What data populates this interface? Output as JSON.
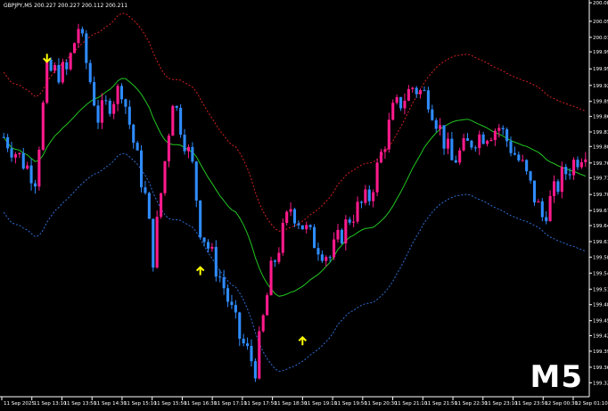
{
  "symbol_line": "GBPJPY,M5  200.227 200.227 200.112 200.211",
  "timeframe_badge": "M5",
  "colors": {
    "background": "#000000",
    "bull_candle": "#ff1a8c",
    "bear_candle": "#2f8cff",
    "middle_band": "#22c522",
    "upper_band": "#d42020",
    "lower_band": "#2f6fd6",
    "signal_arrow": "#ffff00",
    "axis_text": "#ffffff"
  },
  "chart_data": {
    "type": "candlestick",
    "symbol": "GBPJPY",
    "timeframe": "M5",
    "ylim": [
      199.31,
      200.09
    ],
    "y_ticks": [
      200.088,
      200.051,
      200.019,
      199.99,
      199.956,
      199.923,
      199.891,
      199.861,
      199.83,
      199.801,
      199.768,
      199.738,
      199.705,
      199.673,
      199.643,
      199.611,
      199.58,
      199.548,
      199.516,
      199.485,
      199.453,
      199.423,
      199.392,
      199.36,
      199.329
    ],
    "x_ticks": [
      "11 Sep 2025",
      "11 Sep 13:10",
      "11 Sep 13:50",
      "11 Sep 14:30",
      "11 Sep 15:10",
      "11 Sep 15:50",
      "11 Sep 16:30",
      "11 Sep 17:10",
      "11 Sep 17:50",
      "11 Sep 18:30",
      "11 Sep 19:10",
      "11 Sep 19:50",
      "11 Sep 20:30",
      "11 Sep 21:10",
      "11 Sep 21:50",
      "11 Sep 22:30",
      "11 Sep 23:10",
      "11 Sep 23:50",
      "12 Sep 00:30",
      "12 Sep 01:10"
    ],
    "candles": [],
    "signal_arrows": [
      {
        "direction": "down",
        "candle_index": 11,
        "price": 199.97
      },
      {
        "direction": "up",
        "candle_index": 50,
        "price": 199.56
      },
      {
        "direction": "up",
        "candle_index": 76,
        "price": 199.42
      }
    ]
  }
}
